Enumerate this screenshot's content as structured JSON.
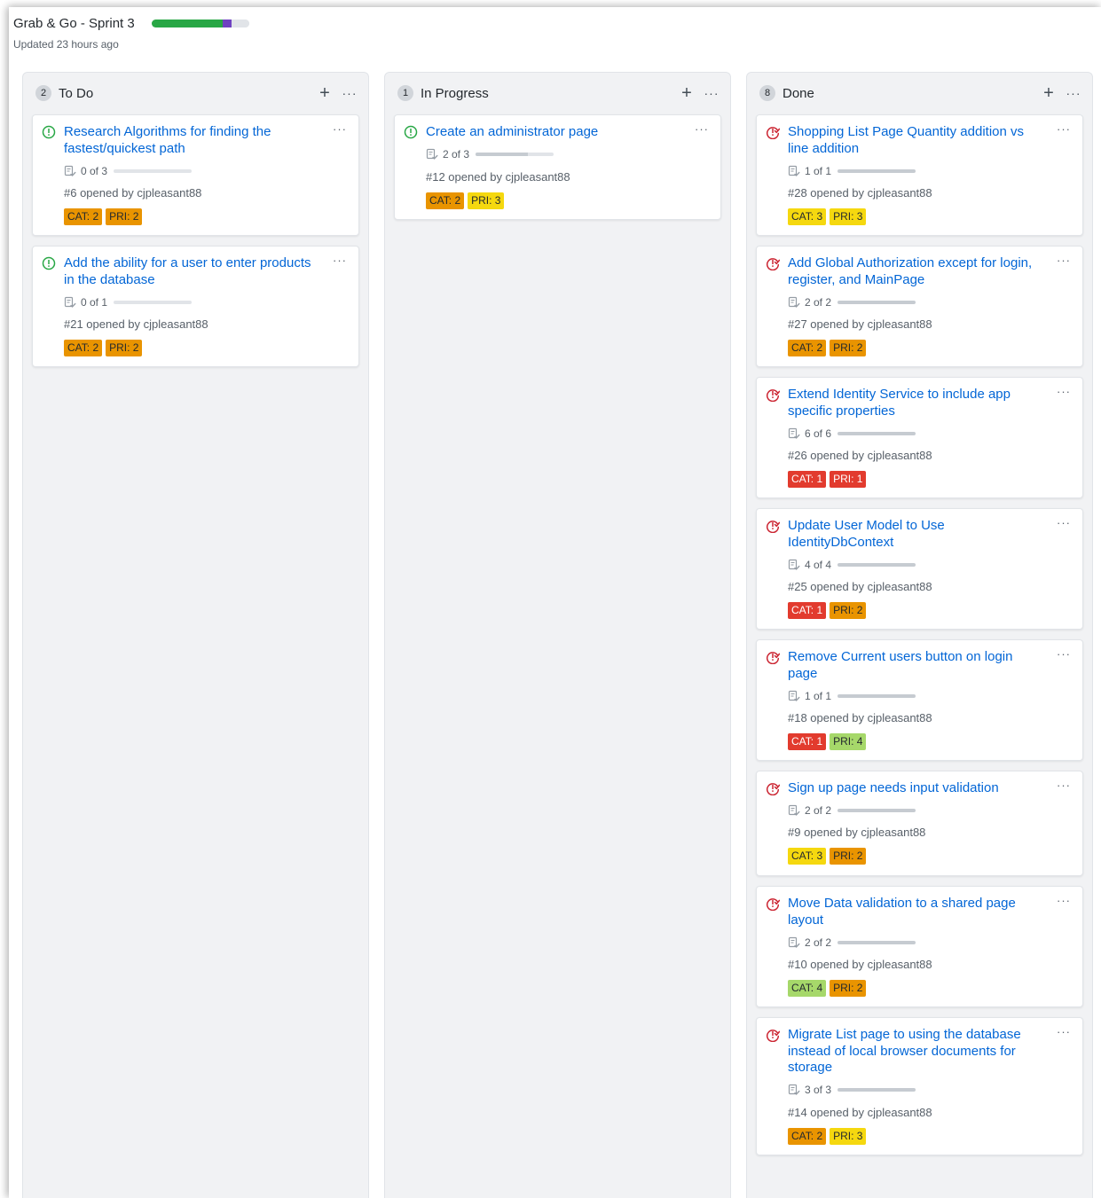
{
  "board": {
    "title": "Grab & Go - Sprint 3",
    "updated": "Updated 23 hours ago",
    "progress": {
      "done": 0.73,
      "in_progress": 0.09,
      "todo": 0.18
    },
    "colors": {
      "done": "#28a745",
      "in_progress": "#6f42c1",
      "todo": "#e1e4e8"
    }
  },
  "colors": {
    "link": "#0366d6",
    "open_icon": "#28a745",
    "closed_icon": "#cb2431",
    "cat1": "#e23b2e",
    "orange": "#e99400",
    "yellow": "#f5d80f",
    "green": "#a6d86a"
  },
  "columns": [
    {
      "name": "To Do",
      "count": "2",
      "cards": [
        {
          "title": "Research Algorithms for finding the fastest/quickest path",
          "tasks": "0 of 3",
          "task_progress": 0,
          "meta": "#6 opened by cjpleasant88",
          "cat": "CAT: 2",
          "pri": "PRI: 2",
          "state": "open"
        },
        {
          "title": "Add the ability for a user to enter products in the database",
          "tasks": "0 of 1",
          "task_progress": 0,
          "meta": "#21 opened by cjpleasant88",
          "cat": "CAT: 2",
          "pri": "PRI: 2",
          "state": "open"
        }
      ]
    },
    {
      "name": "In Progress",
      "count": "1",
      "cards": [
        {
          "title": "Create an administrator page",
          "tasks": "2 of 3",
          "task_progress": 0.667,
          "meta": "#12 opened by cjpleasant88",
          "cat": "CAT: 2",
          "pri": "PRI: 3",
          "state": "open"
        }
      ]
    },
    {
      "name": "Done",
      "count": "8",
      "cards": [
        {
          "title": "Shopping List Page Quantity addition vs line addition",
          "tasks": "1 of 1",
          "task_progress": 1,
          "meta": "#28 opened by cjpleasant88",
          "cat": "CAT: 3",
          "pri": "PRI: 3",
          "state": "closed"
        },
        {
          "title": "Add Global Authorization except for login, register, and MainPage",
          "tasks": "2 of 2",
          "task_progress": 1,
          "meta": "#27 opened by cjpleasant88",
          "cat": "CAT: 2",
          "pri": "PRI: 2",
          "state": "closed"
        },
        {
          "title": "Extend Identity Service to include app specific properties",
          "tasks": "6 of 6",
          "task_progress": 1,
          "meta": "#26 opened by cjpleasant88",
          "cat": "CAT: 1",
          "pri": "PRI: 1",
          "state": "closed"
        },
        {
          "title": "Update User Model to Use IdentityDbContext",
          "tasks": "4 of 4",
          "task_progress": 1,
          "meta": "#25 opened by cjpleasant88",
          "cat": "CAT: 1",
          "pri": "PRI: 2",
          "state": "closed"
        },
        {
          "title": "Remove Current users button on login page",
          "tasks": "1 of 1",
          "task_progress": 1,
          "meta": "#18 opened by cjpleasant88",
          "cat": "CAT: 1",
          "pri": "PRI: 4",
          "state": "closed"
        },
        {
          "title": "Sign up page needs input validation",
          "tasks": "2 of 2",
          "task_progress": 1,
          "meta": "#9 opened by cjpleasant88",
          "cat": "CAT: 3",
          "pri": "PRI: 2",
          "state": "closed"
        },
        {
          "title": "Move Data validation to a shared page layout",
          "tasks": "2 of 2",
          "task_progress": 1,
          "meta": "#10 opened by cjpleasant88",
          "cat": "CAT: 4",
          "pri": "PRI: 2",
          "state": "closed"
        },
        {
          "title": "Migrate List page to using the database instead of local browser documents for storage",
          "tasks": "3 of 3",
          "task_progress": 1,
          "meta": "#14 opened by cjpleasant88",
          "cat": "CAT: 2",
          "pri": "PRI: 3",
          "state": "closed"
        }
      ]
    }
  ]
}
